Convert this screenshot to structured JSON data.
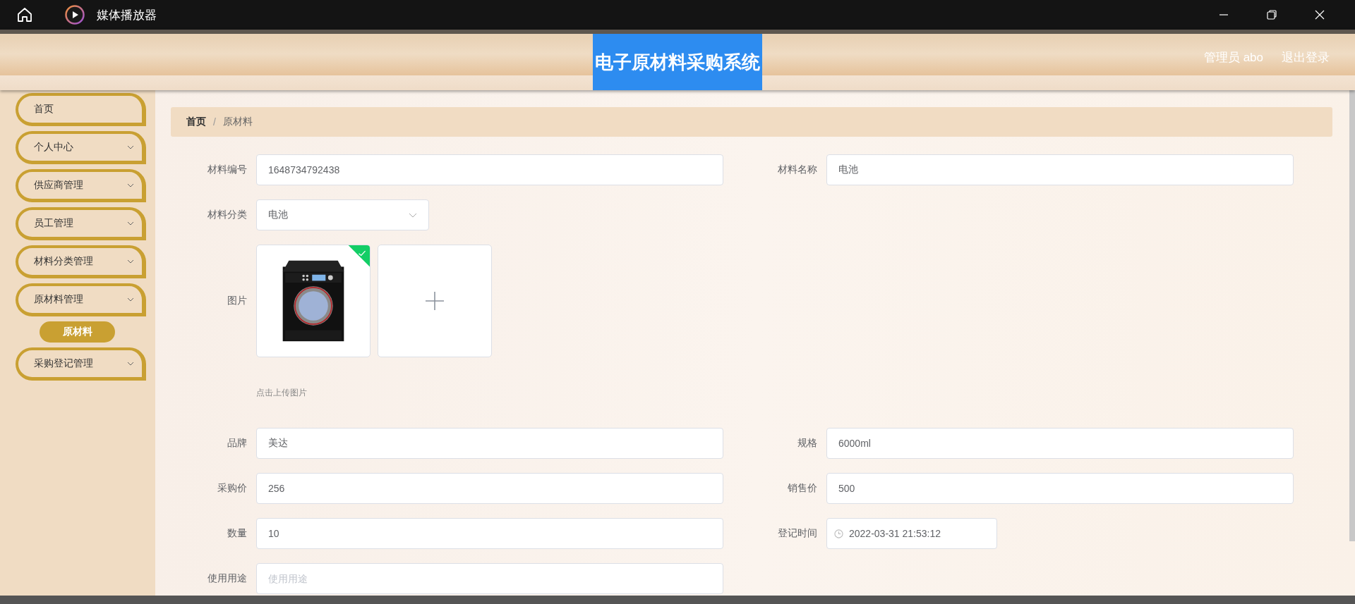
{
  "window": {
    "title": "媒体播放器"
  },
  "header": {
    "title": "电子原材料采购系统",
    "user": "管理员 abo",
    "logout": "退出登录"
  },
  "sidebar": {
    "items": [
      {
        "label": "首页",
        "kind": "link"
      },
      {
        "label": "个人中心",
        "kind": "group"
      },
      {
        "label": "供应商管理",
        "kind": "group"
      },
      {
        "label": "员工管理",
        "kind": "group"
      },
      {
        "label": "材料分类管理",
        "kind": "group"
      },
      {
        "label": "原材料管理",
        "kind": "group",
        "children": [
          {
            "label": "原材料",
            "selected": true
          }
        ]
      },
      {
        "label": "采购登记管理",
        "kind": "group"
      }
    ]
  },
  "breadcrumb": {
    "separator": "/",
    "items": [
      {
        "label": "首页"
      },
      {
        "label": "原材料"
      }
    ]
  },
  "form": {
    "rows": [
      {
        "kind": "pair",
        "fields": [
          {
            "label": "材料编号",
            "kind": "text",
            "value": "1648734792438"
          },
          {
            "label": "材料名称",
            "kind": "text",
            "value": "电池"
          }
        ]
      },
      {
        "kind": "pair",
        "fields": [
          {
            "label": "材料分类",
            "kind": "select",
            "value": "电池"
          }
        ]
      },
      {
        "kind": "upload",
        "label": "图片",
        "uploaded": true,
        "hint": "点击上传图片"
      },
      {
        "kind": "pair",
        "fields": [
          {
            "label": "品牌",
            "kind": "text",
            "value": "美达"
          },
          {
            "label": "规格",
            "kind": "text",
            "value": "6000ml"
          }
        ]
      },
      {
        "kind": "pair",
        "fields": [
          {
            "label": "采购价",
            "kind": "text",
            "value": "256"
          },
          {
            "label": "销售价",
            "kind": "text",
            "value": "500"
          }
        ]
      },
      {
        "kind": "pair",
        "fields": [
          {
            "label": "数量",
            "kind": "text",
            "value": "10"
          },
          {
            "label": "登记时间",
            "kind": "date",
            "value": "2022-03-31 21:53:12"
          }
        ]
      },
      {
        "kind": "pair",
        "fields": [
          {
            "label": "使用用途",
            "kind": "text",
            "placeholder": "使用用途"
          }
        ]
      }
    ]
  }
}
